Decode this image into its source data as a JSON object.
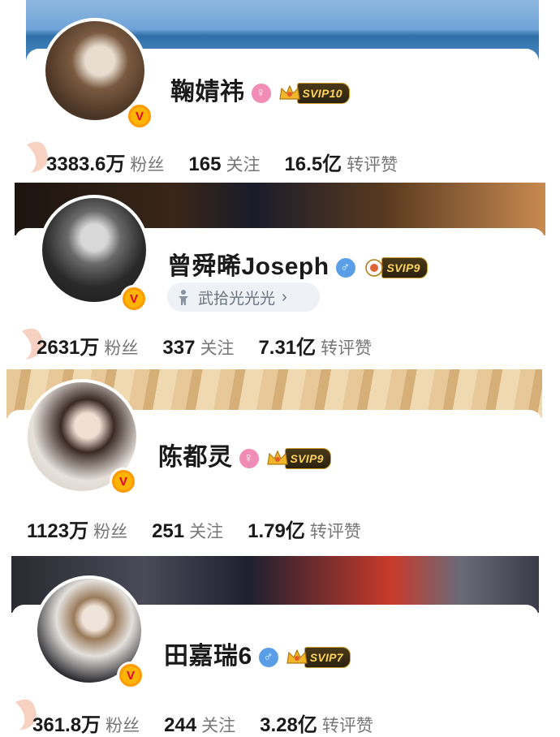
{
  "profiles": [
    {
      "name": "鞠婧祎",
      "gender": "♀",
      "svip": "SVIP10",
      "fans": "3383.6万",
      "fans_label": "粉丝",
      "following": "165",
      "following_label": "关注",
      "interactions": "16.5亿",
      "interactions_label": "转评赞"
    },
    {
      "name": "曾舜晞Joseph",
      "gender": "♂",
      "svip": "SVIP9",
      "tag": "武拾光光光",
      "tag_arrow": "›",
      "fans": "2631万",
      "fans_label": "粉丝",
      "following": "337",
      "following_label": "关注",
      "interactions": "7.31亿",
      "interactions_label": "转评赞"
    },
    {
      "name": "陈都灵",
      "gender": "♀",
      "svip": "SVIP9",
      "fans": "1123万",
      "fans_label": "粉丝",
      "following": "251",
      "following_label": "关注",
      "interactions": "1.79亿",
      "interactions_label": "转评赞"
    },
    {
      "name": "田嘉瑞6",
      "gender": "♂",
      "svip": "SVIP7",
      "fans": "361.8万",
      "fans_label": "粉丝",
      "following": "244",
      "following_label": "关注",
      "interactions": "3.28亿",
      "interactions_label": "转评赞"
    }
  ],
  "verified_badge": "V",
  "colors": {
    "female": "#f08cb5",
    "male": "#5a9ee8",
    "verified": "#ff9a00",
    "svip_gold": "#ffd35a"
  }
}
